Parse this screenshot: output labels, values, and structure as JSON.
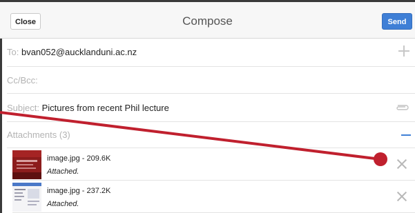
{
  "header": {
    "close_label": "Close",
    "title": "Compose",
    "send_label": "Send"
  },
  "fields": {
    "to_label": "To:",
    "to_value": "bvan052@aucklanduni.ac.nz",
    "cc_label": "Cc/Bcc:",
    "subject_label": "Subject:",
    "subject_value": "Pictures from recent Phil lecture",
    "attachments_label": "Attachments (3)"
  },
  "attachments": [
    {
      "name": "image.jpg - 209.6K",
      "status": "Attached."
    },
    {
      "name": "image.jpg - 237.2K",
      "status": "Attached."
    }
  ],
  "icons": {
    "add": "plus-icon",
    "attach": "paperclip-icon",
    "collapse": "minus-icon",
    "remove": "close-icon"
  },
  "colors": {
    "accent": "#3f7fd6",
    "annotation": "#c0202e"
  }
}
